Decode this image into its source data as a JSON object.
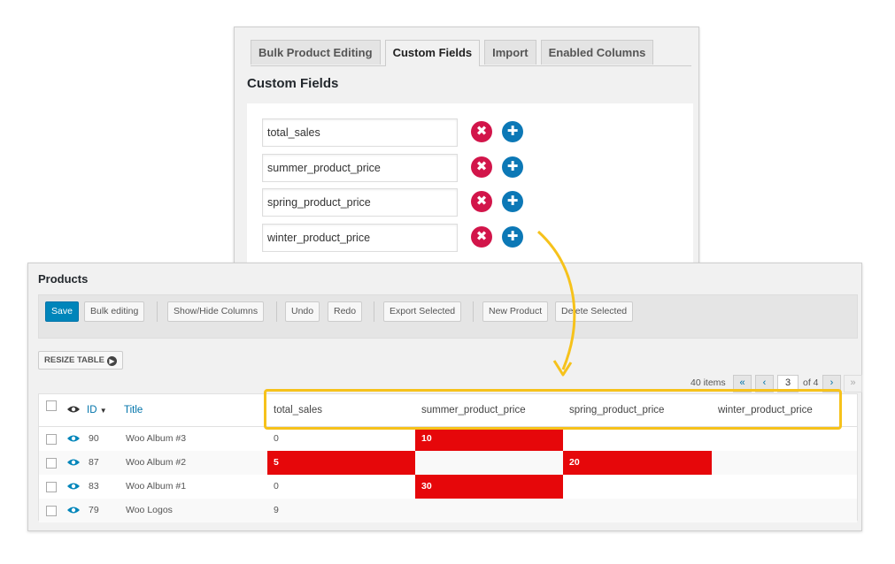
{
  "custom_fields_panel": {
    "tabs": [
      "Bulk Product Editing",
      "Custom Fields",
      "Import",
      "Enabled Columns"
    ],
    "active_tab": "Custom Fields",
    "title": "Custom Fields",
    "fields": [
      "total_sales",
      "summer_product_price",
      "spring_product_price",
      "winter_product_price"
    ],
    "remove_icon_glyph": "✖",
    "add_icon_glyph": "✚"
  },
  "products_panel": {
    "title": "Products",
    "toolbar": {
      "save": "Save",
      "bulk_editing": "Bulk editing",
      "show_hide_columns": "Show/Hide Columns",
      "undo": "Undo",
      "redo": "Redo",
      "export_selected": "Export Selected",
      "new_product": "New Product",
      "delete_selected": "Delete Selected"
    },
    "resize_table": "RESIZE TABLE",
    "pagination": {
      "items": "40 items",
      "first": "«",
      "prev": "‹",
      "current": "3",
      "of": "of 4",
      "next": "›",
      "last": "»"
    },
    "columns": {
      "id": "ID",
      "sort_glyph": "▼",
      "title": "Title",
      "total_sales": "total_sales",
      "summer_product_price": "summer_product_price",
      "spring_product_price": "spring_product_price",
      "winter_product_price": "winter_product_price"
    },
    "rows": [
      {
        "id": "90",
        "title": "Woo Album #3",
        "total_sales": "0",
        "summer": "10",
        "spring": "",
        "winter": ""
      },
      {
        "id": "87",
        "title": "Woo Album #2",
        "total_sales": "5",
        "summer": "",
        "spring": "20",
        "winter": ""
      },
      {
        "id": "83",
        "title": "Woo Album #1",
        "total_sales": "0",
        "summer": "30",
        "spring": "",
        "winter": ""
      },
      {
        "id": "79",
        "title": "Woo Logos",
        "total_sales": "9",
        "summer": "",
        "spring": "",
        "winter": ""
      }
    ]
  },
  "colors": {
    "highlight": "#f6c21b",
    "changed_cell": "#e6070a",
    "primary": "#0085ba",
    "remove": "#d2154a",
    "add": "#0c78b6"
  }
}
